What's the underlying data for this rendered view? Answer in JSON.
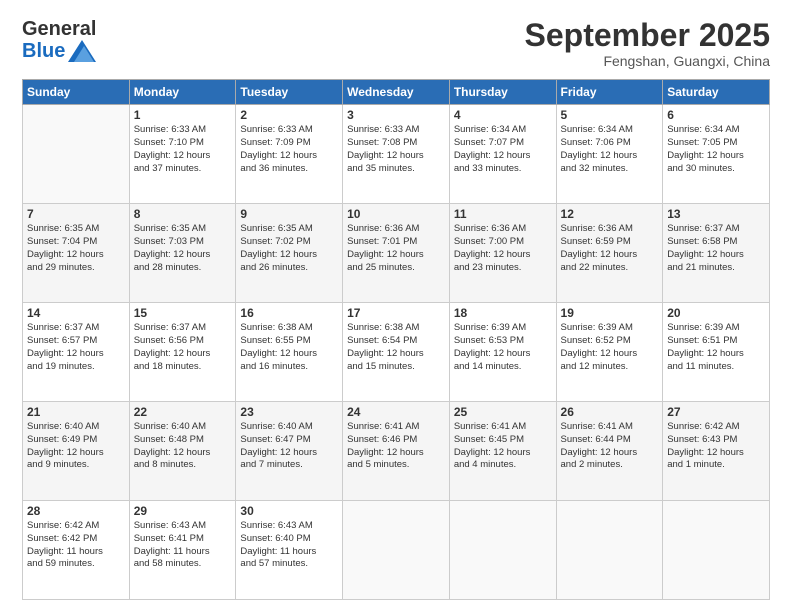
{
  "logo": {
    "general": "General",
    "blue": "Blue"
  },
  "header": {
    "month": "September 2025",
    "location": "Fengshan, Guangxi, China"
  },
  "days": [
    "Sunday",
    "Monday",
    "Tuesday",
    "Wednesday",
    "Thursday",
    "Friday",
    "Saturday"
  ],
  "weeks": [
    [
      {
        "day": "",
        "content": ""
      },
      {
        "day": "1",
        "content": "Sunrise: 6:33 AM\nSunset: 7:10 PM\nDaylight: 12 hours\nand 37 minutes."
      },
      {
        "day": "2",
        "content": "Sunrise: 6:33 AM\nSunset: 7:09 PM\nDaylight: 12 hours\nand 36 minutes."
      },
      {
        "day": "3",
        "content": "Sunrise: 6:33 AM\nSunset: 7:08 PM\nDaylight: 12 hours\nand 35 minutes."
      },
      {
        "day": "4",
        "content": "Sunrise: 6:34 AM\nSunset: 7:07 PM\nDaylight: 12 hours\nand 33 minutes."
      },
      {
        "day": "5",
        "content": "Sunrise: 6:34 AM\nSunset: 7:06 PM\nDaylight: 12 hours\nand 32 minutes."
      },
      {
        "day": "6",
        "content": "Sunrise: 6:34 AM\nSunset: 7:05 PM\nDaylight: 12 hours\nand 30 minutes."
      }
    ],
    [
      {
        "day": "7",
        "content": "Sunrise: 6:35 AM\nSunset: 7:04 PM\nDaylight: 12 hours\nand 29 minutes."
      },
      {
        "day": "8",
        "content": "Sunrise: 6:35 AM\nSunset: 7:03 PM\nDaylight: 12 hours\nand 28 minutes."
      },
      {
        "day": "9",
        "content": "Sunrise: 6:35 AM\nSunset: 7:02 PM\nDaylight: 12 hours\nand 26 minutes."
      },
      {
        "day": "10",
        "content": "Sunrise: 6:36 AM\nSunset: 7:01 PM\nDaylight: 12 hours\nand 25 minutes."
      },
      {
        "day": "11",
        "content": "Sunrise: 6:36 AM\nSunset: 7:00 PM\nDaylight: 12 hours\nand 23 minutes."
      },
      {
        "day": "12",
        "content": "Sunrise: 6:36 AM\nSunset: 6:59 PM\nDaylight: 12 hours\nand 22 minutes."
      },
      {
        "day": "13",
        "content": "Sunrise: 6:37 AM\nSunset: 6:58 PM\nDaylight: 12 hours\nand 21 minutes."
      }
    ],
    [
      {
        "day": "14",
        "content": "Sunrise: 6:37 AM\nSunset: 6:57 PM\nDaylight: 12 hours\nand 19 minutes."
      },
      {
        "day": "15",
        "content": "Sunrise: 6:37 AM\nSunset: 6:56 PM\nDaylight: 12 hours\nand 18 minutes."
      },
      {
        "day": "16",
        "content": "Sunrise: 6:38 AM\nSunset: 6:55 PM\nDaylight: 12 hours\nand 16 minutes."
      },
      {
        "day": "17",
        "content": "Sunrise: 6:38 AM\nSunset: 6:54 PM\nDaylight: 12 hours\nand 15 minutes."
      },
      {
        "day": "18",
        "content": "Sunrise: 6:39 AM\nSunset: 6:53 PM\nDaylight: 12 hours\nand 14 minutes."
      },
      {
        "day": "19",
        "content": "Sunrise: 6:39 AM\nSunset: 6:52 PM\nDaylight: 12 hours\nand 12 minutes."
      },
      {
        "day": "20",
        "content": "Sunrise: 6:39 AM\nSunset: 6:51 PM\nDaylight: 12 hours\nand 11 minutes."
      }
    ],
    [
      {
        "day": "21",
        "content": "Sunrise: 6:40 AM\nSunset: 6:49 PM\nDaylight: 12 hours\nand 9 minutes."
      },
      {
        "day": "22",
        "content": "Sunrise: 6:40 AM\nSunset: 6:48 PM\nDaylight: 12 hours\nand 8 minutes."
      },
      {
        "day": "23",
        "content": "Sunrise: 6:40 AM\nSunset: 6:47 PM\nDaylight: 12 hours\nand 7 minutes."
      },
      {
        "day": "24",
        "content": "Sunrise: 6:41 AM\nSunset: 6:46 PM\nDaylight: 12 hours\nand 5 minutes."
      },
      {
        "day": "25",
        "content": "Sunrise: 6:41 AM\nSunset: 6:45 PM\nDaylight: 12 hours\nand 4 minutes."
      },
      {
        "day": "26",
        "content": "Sunrise: 6:41 AM\nSunset: 6:44 PM\nDaylight: 12 hours\nand 2 minutes."
      },
      {
        "day": "27",
        "content": "Sunrise: 6:42 AM\nSunset: 6:43 PM\nDaylight: 12 hours\nand 1 minute."
      }
    ],
    [
      {
        "day": "28",
        "content": "Sunrise: 6:42 AM\nSunset: 6:42 PM\nDaylight: 11 hours\nand 59 minutes."
      },
      {
        "day": "29",
        "content": "Sunrise: 6:43 AM\nSunset: 6:41 PM\nDaylight: 11 hours\nand 58 minutes."
      },
      {
        "day": "30",
        "content": "Sunrise: 6:43 AM\nSunset: 6:40 PM\nDaylight: 11 hours\nand 57 minutes."
      },
      {
        "day": "",
        "content": ""
      },
      {
        "day": "",
        "content": ""
      },
      {
        "day": "",
        "content": ""
      },
      {
        "day": "",
        "content": ""
      }
    ]
  ]
}
